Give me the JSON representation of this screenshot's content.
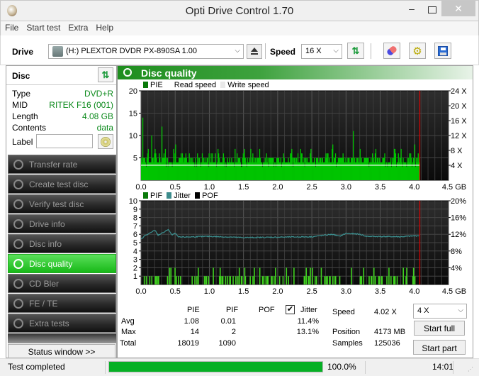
{
  "window": {
    "title": "Opti Drive Control 1.70"
  },
  "menu": [
    "File",
    "Start test",
    "Extra",
    "Help"
  ],
  "toolbar": {
    "drive_label": "Drive",
    "drive_value": "(H:)  PLEXTOR DVDR   PX-890SA 1.00",
    "speed_label": "Speed",
    "speed_value": "16 X",
    "buttons": [
      "refresh-icon",
      "eraser-icon",
      "settings-icon",
      "save-icon"
    ]
  },
  "disc": {
    "header": "Disc",
    "rows": [
      {
        "key": "Type",
        "value": "DVD+R"
      },
      {
        "key": "MID",
        "value": "RITEK F16 (001)"
      },
      {
        "key": "Length",
        "value": "4.08 GB"
      },
      {
        "key": "Contents",
        "value": "data"
      }
    ],
    "label_key": "Label",
    "label_value": ""
  },
  "nav": [
    {
      "label": "Transfer rate",
      "active": false
    },
    {
      "label": "Create test disc",
      "active": false
    },
    {
      "label": "Verify test disc",
      "active": false
    },
    {
      "label": "Drive info",
      "active": false
    },
    {
      "label": "Disc info",
      "active": false
    },
    {
      "label": "Disc quality",
      "active": true
    },
    {
      "label": "CD Bler",
      "active": false
    },
    {
      "label": "FE / TE",
      "active": false
    },
    {
      "label": "Extra tests",
      "active": false
    }
  ],
  "status_window_button": "Status window >>",
  "panel": {
    "title": "Disc quality"
  },
  "chart_data": [
    {
      "type": "bar",
      "title": "PIE / Read speed",
      "legend": [
        {
          "name": "PIE",
          "color": "#00c000"
        },
        {
          "name": "Read speed",
          "color": "#ffffff"
        },
        {
          "name": "Write speed",
          "color": "#e8e8e8"
        }
      ],
      "xlabel": "GB",
      "x_ticks": [
        "0.0",
        "0.5",
        "1.0",
        "1.5",
        "2.0",
        "2.5",
        "3.0",
        "3.5",
        "4.0",
        "4.5 GB"
      ],
      "xlim": [
        0,
        4.5
      ],
      "ylim": [
        0,
        20
      ],
      "y_ticks": [
        "5",
        "10",
        "15",
        "20"
      ],
      "y2_ticks": [
        "4 X",
        "8 X",
        "12 X",
        "16 X",
        "20 X",
        "24 X"
      ],
      "y2lim": [
        0,
        24
      ],
      "pie_baseline": 4,
      "pie_peaks": [
        [
          0.02,
          14
        ],
        [
          0.15,
          10
        ],
        [
          0.3,
          12
        ],
        [
          0.5,
          8
        ],
        [
          0.1,
          7
        ],
        [
          0.2,
          7
        ],
        [
          0.35,
          7
        ],
        [
          0.7,
          6
        ],
        [
          1.2,
          6
        ],
        [
          1.6,
          7
        ],
        [
          2.2,
          7
        ],
        [
          2.8,
          8
        ],
        [
          3.1,
          11
        ],
        [
          3.2,
          7
        ],
        [
          3.7,
          7
        ],
        [
          4.0,
          8
        ],
        [
          4.05,
          6
        ]
      ],
      "read_speed_x": 4.02,
      "end_marker_gb": 4.08
    },
    {
      "type": "bar",
      "title": "PIF / Jitter / POF",
      "legend": [
        {
          "name": "PIF",
          "color": "#00c000"
        },
        {
          "name": "Jitter",
          "color": "#3c8c8c"
        },
        {
          "name": "POF",
          "color": "#000000"
        }
      ],
      "x_ticks": [
        "0.0",
        "0.5",
        "1.0",
        "1.5",
        "2.0",
        "2.5",
        "3.0",
        "3.5",
        "4.0",
        "4.5 GB"
      ],
      "xlim": [
        0,
        4.5
      ],
      "ylim": [
        0,
        10
      ],
      "y_ticks": [
        "1",
        "2",
        "3",
        "4",
        "5",
        "6",
        "7",
        "8",
        "9",
        "10"
      ],
      "y2_ticks": [
        "4%",
        "8%",
        "12%",
        "16%",
        "20%"
      ],
      "y2lim": [
        0,
        20
      ],
      "jitter_points": [
        [
          0,
          10.8
        ],
        [
          0.05,
          11.6
        ],
        [
          0.15,
          12.4
        ],
        [
          0.2,
          13.0
        ],
        [
          0.25,
          11.8
        ],
        [
          0.35,
          12.6
        ],
        [
          0.4,
          13.2
        ],
        [
          0.45,
          11.8
        ],
        [
          0.5,
          12.2
        ],
        [
          0.55,
          11.3
        ],
        [
          1.0,
          11.5
        ],
        [
          1.5,
          11.2
        ],
        [
          2.0,
          11.3
        ],
        [
          2.5,
          11.4
        ],
        [
          2.8,
          12.0
        ],
        [
          2.9,
          11.5
        ],
        [
          3.0,
          12.2
        ],
        [
          3.2,
          12.0
        ],
        [
          3.3,
          11.5
        ],
        [
          3.8,
          11.4
        ],
        [
          4.0,
          11.6
        ],
        [
          4.08,
          11.7
        ]
      ],
      "pif_max": 2,
      "end_marker_gb": 4.08
    }
  ],
  "stats": {
    "columns": [
      "PIE",
      "PIF",
      "POF",
      "Jitter"
    ],
    "jitter_checked": true,
    "rows": [
      {
        "label": "Avg",
        "pie": "1.08",
        "pif": "0.01",
        "pof": "",
        "jitter": "11.4%"
      },
      {
        "label": "Max",
        "pie": "14",
        "pif": "2",
        "pof": "",
        "jitter": "13.1%"
      },
      {
        "label": "Total",
        "pie": "18019",
        "pif": "1090",
        "pof": "",
        "jitter": ""
      }
    ],
    "speed_label": "Speed",
    "speed_value": "4.02 X",
    "position_label": "Position",
    "position_value": "4173 MB",
    "samples_label": "Samples",
    "samples_value": "125036",
    "speed_select": "4 X",
    "start_full": "Start full",
    "start_part": "Start part"
  },
  "statusbar": {
    "text": "Test completed",
    "progress": 1.0,
    "progress_text": "100.0%",
    "time": "14:01"
  }
}
